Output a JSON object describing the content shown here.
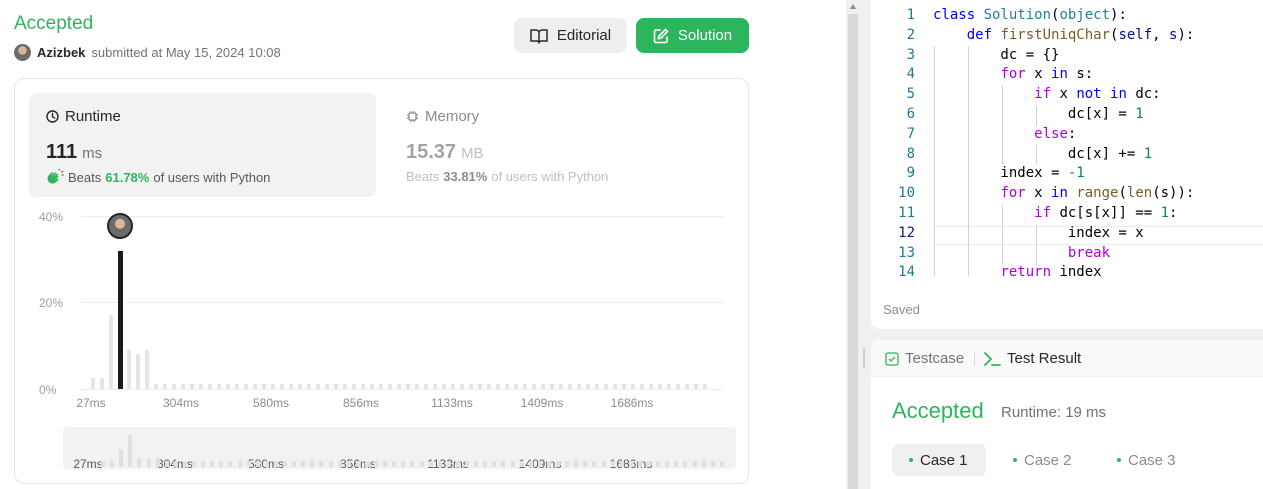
{
  "submission": {
    "status": "Accepted",
    "user": "Azizbek",
    "submitted_text": "submitted at May 15, 2024 10:08",
    "editorial_label": "Editorial",
    "solution_label": "Solution"
  },
  "runtime": {
    "title": "Runtime",
    "value": "111",
    "unit": "ms",
    "beats_prefix": "Beats",
    "beats_pct": "61.78%",
    "beats_suffix": "of users with Python"
  },
  "memory": {
    "title": "Memory",
    "value": "15.37",
    "unit": "MB",
    "beats_prefix": "Beats",
    "beats_pct": "33.81%",
    "beats_suffix": "of users with Python"
  },
  "chart_data": {
    "type": "bar",
    "ylabels": [
      "40%",
      "20%",
      "0%"
    ],
    "ylim": [
      0,
      40
    ],
    "xlabels": [
      "27ms",
      "304ms",
      "580ms",
      "856ms",
      "1133ms",
      "1409ms",
      "1686ms"
    ],
    "values": [
      2.5,
      2.5,
      17,
      32,
      9,
      8,
      9,
      1.2,
      1.2,
      1.2,
      1.2,
      1.2,
      1.2,
      1.2,
      1.2,
      1.2,
      1.2,
      1.2,
      1.2,
      1.2,
      1.2,
      1.2,
      1.2,
      1.2,
      1.2,
      1.2,
      1.2,
      1.2,
      1.2,
      1.2,
      1.2,
      1.2,
      1.2,
      1.2,
      1.2,
      1.2,
      1.2,
      1.2,
      1.2,
      1.2,
      1.2,
      1.2,
      1.2,
      1.2,
      1.2,
      1.2,
      1.2,
      1.2,
      1.2,
      1.2,
      1.2,
      1.2,
      1.2,
      1.2,
      1.2,
      1.2,
      1.2,
      1.2,
      1.2,
      1.2,
      1.2,
      1.2,
      1.2,
      1.2,
      1.2,
      1.2,
      1.2,
      1.2,
      1.2
    ],
    "highlight_index": 3,
    "grid": true
  },
  "code": {
    "lines": [
      [
        [
          "k",
          "class "
        ],
        [
          "cls",
          "Solution"
        ],
        [
          "",
          "("
        ],
        [
          "cls",
          "object"
        ],
        [
          "",
          "):"
        ]
      ],
      [
        [
          "",
          "    "
        ],
        [
          "k",
          "def "
        ],
        [
          "fn",
          "firstUniqChar"
        ],
        [
          "",
          "("
        ],
        [
          "p",
          "self"
        ],
        [
          "",
          ", "
        ],
        [
          "p",
          "s"
        ],
        [
          "",
          "):"
        ]
      ],
      [
        [
          "",
          "        dc = {}"
        ]
      ],
      [
        [
          "",
          "        "
        ],
        [
          "kw",
          "for "
        ],
        [
          "",
          "x "
        ],
        [
          "k",
          "in "
        ],
        [
          "",
          "s:"
        ]
      ],
      [
        [
          "",
          "            "
        ],
        [
          "kw",
          "if "
        ],
        [
          "",
          "x "
        ],
        [
          "k",
          "not in "
        ],
        [
          "",
          "dc:"
        ]
      ],
      [
        [
          "",
          "                dc[x] = "
        ],
        [
          "n",
          "1"
        ]
      ],
      [
        [
          "",
          "            "
        ],
        [
          "kw",
          "else"
        ],
        [
          "",
          ":"
        ]
      ],
      [
        [
          "",
          "                dc[x] += "
        ],
        [
          "n",
          "1"
        ]
      ],
      [
        [
          "",
          "        index = "
        ],
        [
          "n",
          "-1"
        ]
      ],
      [
        [
          "",
          "        "
        ],
        [
          "kw",
          "for "
        ],
        [
          "",
          "x "
        ],
        [
          "k",
          "in "
        ],
        [
          "fn",
          "range"
        ],
        [
          "",
          "("
        ],
        [
          "fn",
          "len"
        ],
        [
          "",
          "(s)):"
        ]
      ],
      [
        [
          "",
          "            "
        ],
        [
          "kw",
          "if "
        ],
        [
          "",
          "dc[s[x]] == "
        ],
        [
          "n",
          "1"
        ],
        [
          "",
          ":"
        ]
      ],
      [
        [
          "",
          "                index = x"
        ]
      ],
      [
        [
          "",
          "                "
        ],
        [
          "kw",
          "break"
        ]
      ],
      [
        [
          "",
          "        "
        ],
        [
          "kw",
          "return "
        ],
        [
          "",
          "index"
        ]
      ]
    ],
    "active_line": 12,
    "saved_label": "Saved"
  },
  "test": {
    "tab_testcase": "Testcase",
    "tab_result": "Test Result",
    "status": "Accepted",
    "runtime": "Runtime: 19 ms",
    "cases": [
      "Case 1",
      "Case 2",
      "Case 3"
    ],
    "active_case": 0
  },
  "colors": {
    "accent": "#2db55d",
    "bar": "#e5e5e5",
    "highlight_bar": "#1a1a1a"
  }
}
